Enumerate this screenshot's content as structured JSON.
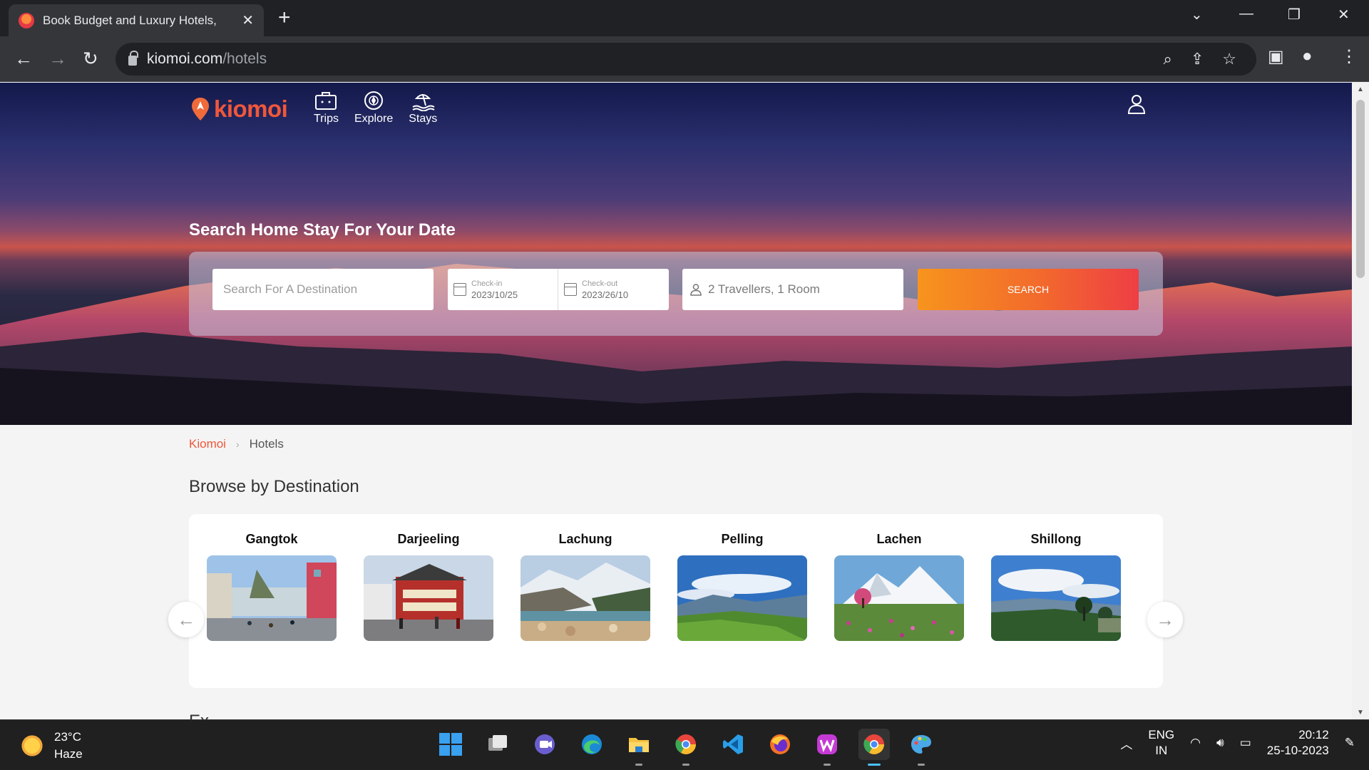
{
  "browser": {
    "tab_title": "Book Budget and Luxury Hotels,",
    "url_host": "kiomoi.com",
    "url_path": "/hotels"
  },
  "site": {
    "brand": "kiomoi",
    "nav": [
      {
        "label": "Trips",
        "icon": "suitcase-icon"
      },
      {
        "label": "Explore",
        "icon": "compass-icon"
      },
      {
        "label": "Stays",
        "icon": "beach-icon"
      }
    ]
  },
  "hero": {
    "title": "Search Home Stay For Your Date",
    "destination_placeholder": "Search For A Destination",
    "checkin_label": "Check-in",
    "checkin_value": "2023/10/25",
    "checkout_label": "Check-out",
    "checkout_value": "2023/26/10",
    "travellers": "2 Travellers, 1 Room",
    "search_label": "SEARCH"
  },
  "breadcrumb": {
    "home": "Kiomoi",
    "separator": "›",
    "current": "Hotels"
  },
  "browse": {
    "title": "Browse by Destination",
    "destinations": [
      "Gangtok",
      "Darjeeling",
      "Lachung",
      "Pelling",
      "Lachen",
      "Shillong"
    ],
    "prev_arrow": "←",
    "next_arrow": "→"
  },
  "next_section_partial": "Ex",
  "taskbar": {
    "temp": "23°C",
    "weather": "Haze",
    "lang_top": "ENG",
    "lang_bottom": "IN",
    "time": "20:12",
    "date": "25-10-2023"
  }
}
